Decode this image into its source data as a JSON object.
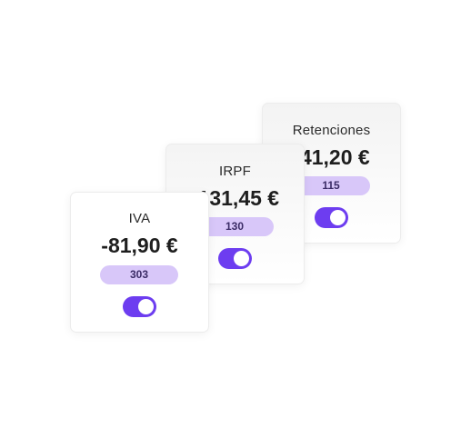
{
  "cards": [
    {
      "label": "IVA",
      "amount": "-81,90 €",
      "badge": "303",
      "toggle_on": true
    },
    {
      "label": "IRPF",
      "amount": "-131,45 €",
      "badge": "130",
      "toggle_on": true
    },
    {
      "label": "Retenciones",
      "amount": "-41,20 €",
      "badge": "115",
      "toggle_on": true
    }
  ],
  "colors": {
    "accent": "#6d3df0",
    "badge_bg": "#d8c7f9",
    "badge_text": "#3b2c66"
  }
}
